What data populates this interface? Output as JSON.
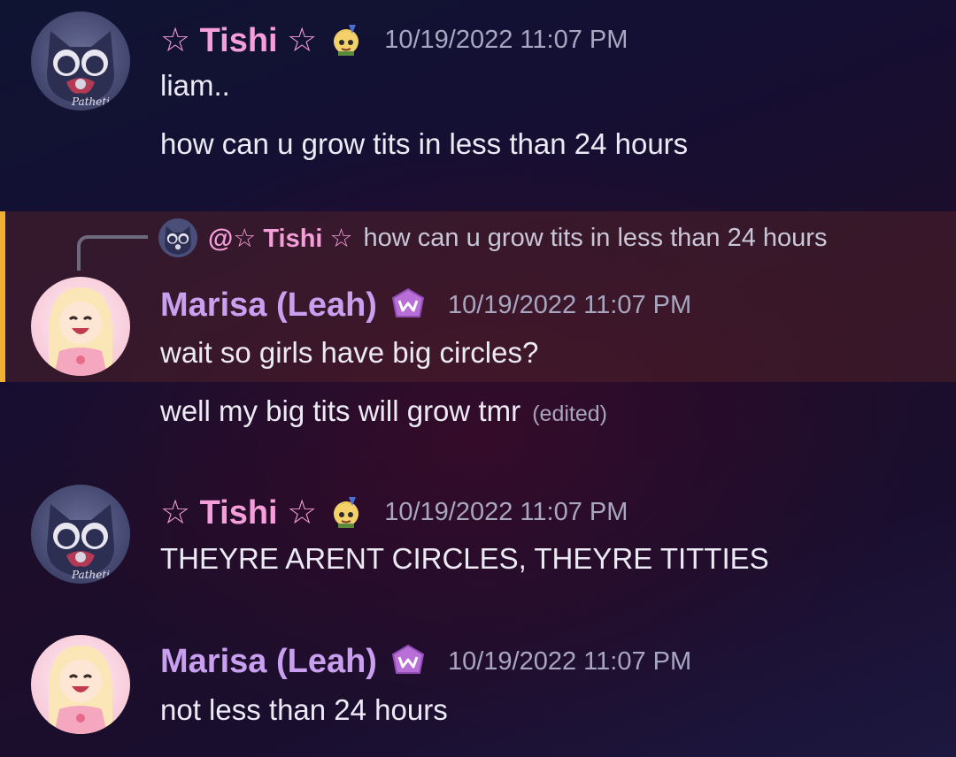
{
  "messages": [
    {
      "author": "☆ Tishi ☆",
      "timestamp": "10/19/2022 11:07 PM",
      "lines": [
        "liam..",
        "how can u grow tits in less than 24 hours"
      ],
      "avatar_text": "Pathetic",
      "badge_icon": "anime-girl-emoji"
    },
    {
      "reply_to": {
        "mention": "@☆ Tishi ☆",
        "preview": "how can u grow tits in less than 24 hours"
      },
      "author": "Marisa (Leah)",
      "timestamp": "10/19/2022 11:07 PM",
      "lines": [
        "wait so girls have big circles?"
      ],
      "badge_icon": "crown-badge"
    },
    {
      "continuation": true,
      "lines": [
        "well my big tits will grow tmr"
      ],
      "edited_label": "(edited)"
    },
    {
      "author": "☆ Tishi ☆",
      "timestamp": "10/19/2022 11:07 PM",
      "lines": [
        "THEYRE ARENT CIRCLES, THEYRE TITTIES"
      ],
      "avatar_text": "Pathetic",
      "badge_icon": "anime-girl-emoji"
    },
    {
      "author": "Marisa (Leah)",
      "timestamp": "10/19/2022 11:07 PM",
      "lines": [
        "not less than 24 hours"
      ],
      "badge_icon": "crown-badge"
    }
  ],
  "colors": {
    "tishi_name": "#f59ed9",
    "marisa_name": "#c9a0f0",
    "reply_accent": "#f0b132",
    "timestamp": "#a8a6c0"
  }
}
